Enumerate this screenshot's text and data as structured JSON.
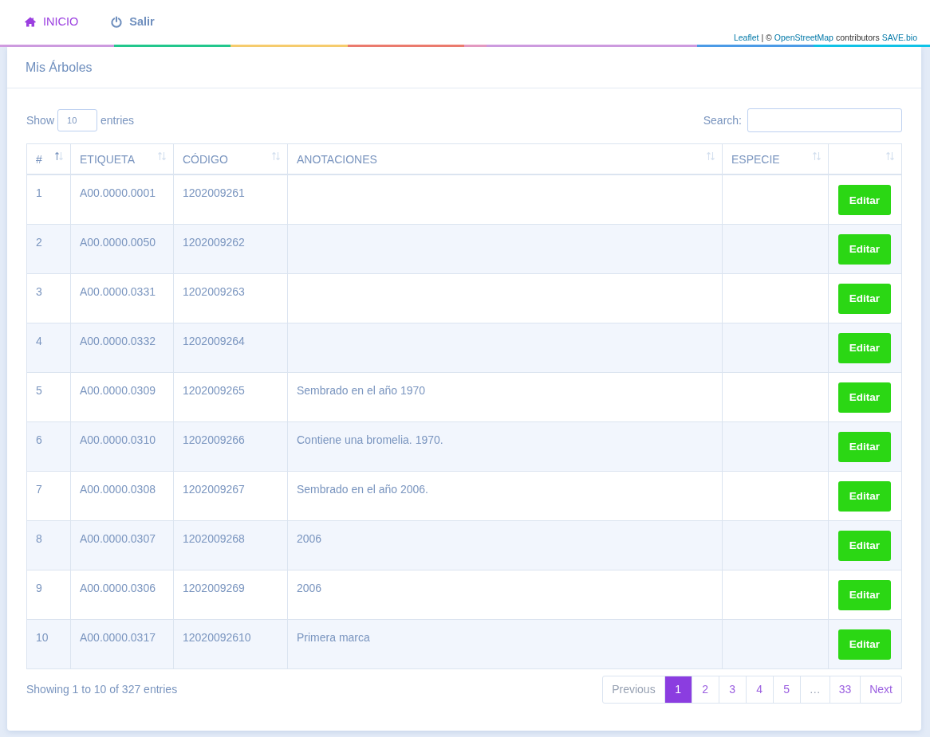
{
  "nav": [
    {
      "label": "INICIO",
      "selected": true
    },
    {
      "label": "Salir",
      "selected": false
    }
  ],
  "attribution": [
    {
      "kind": "link",
      "text": "Leaflet"
    },
    {
      "kind": "text",
      "text": "| ©"
    },
    {
      "kind": "link",
      "text": "OpenStreetMap"
    },
    {
      "kind": "text",
      "text": "contributors"
    },
    {
      "kind": "link",
      "text": "SAVE.bio"
    }
  ],
  "card": {
    "title": "Mis Árboles"
  },
  "length": {
    "label_before": "Show",
    "value": "10",
    "label_after": "entries"
  },
  "search": {
    "label": "Search:"
  },
  "table": {
    "columns": [
      {
        "label": "#",
        "sorted": true
      },
      {
        "label": "ETIQUETA",
        "sorted": false
      },
      {
        "label": "CÓDIGO",
        "sorted": false
      },
      {
        "label": "ANOTACIONES",
        "sorted": false
      },
      {
        "label": "ESPECIE",
        "sorted": false
      },
      {
        "sorted": false
      }
    ],
    "rows": [
      {
        "num": "1",
        "etiqueta": "A00.0000.0001",
        "codigo": "1202009261",
        "action": "Editar"
      },
      {
        "num": "2",
        "etiqueta": "A00.0000.0050",
        "codigo": "1202009262",
        "action": "Editar"
      },
      {
        "num": "3",
        "etiqueta": "A00.0000.0331",
        "codigo": "1202009263",
        "action": "Editar"
      },
      {
        "num": "4",
        "etiqueta": "A00.0000.0332",
        "codigo": "1202009264",
        "action": "Editar"
      },
      {
        "num": "5",
        "etiqueta": "A00.0000.0309",
        "codigo": "1202009265",
        "anotaciones": "Sembrado en el año 1970",
        "action": "Editar"
      },
      {
        "num": "6",
        "etiqueta": "A00.0000.0310",
        "codigo": "1202009266",
        "anotaciones": "Contiene una bromelia. 1970.",
        "action": "Editar"
      },
      {
        "num": "7",
        "etiqueta": "A00.0000.0308",
        "codigo": "1202009267",
        "anotaciones": "Sembrado en el año 2006.",
        "action": "Editar"
      },
      {
        "num": "8",
        "etiqueta": "A00.0000.0307",
        "codigo": "1202009268",
        "anotaciones": "2006",
        "action": "Editar"
      },
      {
        "num": "9",
        "etiqueta": "A00.0000.0306",
        "codigo": "1202009269",
        "anotaciones": "2006",
        "action": "Editar"
      },
      {
        "num": "10",
        "etiqueta": "A00.0000.0317",
        "codigo": "12020092610",
        "anotaciones": "Primera marca",
        "action": "Editar"
      }
    ]
  },
  "info": "Showing 1 to 10 of 327 entries",
  "pagination": [
    {
      "label": "Previous",
      "disabled": true,
      "selected": false
    },
    {
      "label": "1",
      "disabled": false,
      "selected": true
    },
    {
      "label": "2",
      "disabled": false,
      "selected": false
    },
    {
      "label": "3",
      "disabled": false,
      "selected": false
    },
    {
      "label": "4",
      "disabled": false,
      "selected": false
    },
    {
      "label": "5",
      "disabled": false,
      "selected": false
    },
    {
      "label": "…",
      "disabled": true,
      "selected": false
    },
    {
      "label": "33",
      "disabled": false,
      "selected": false
    },
    {
      "label": "Next",
      "disabled": false,
      "selected": false
    }
  ]
}
